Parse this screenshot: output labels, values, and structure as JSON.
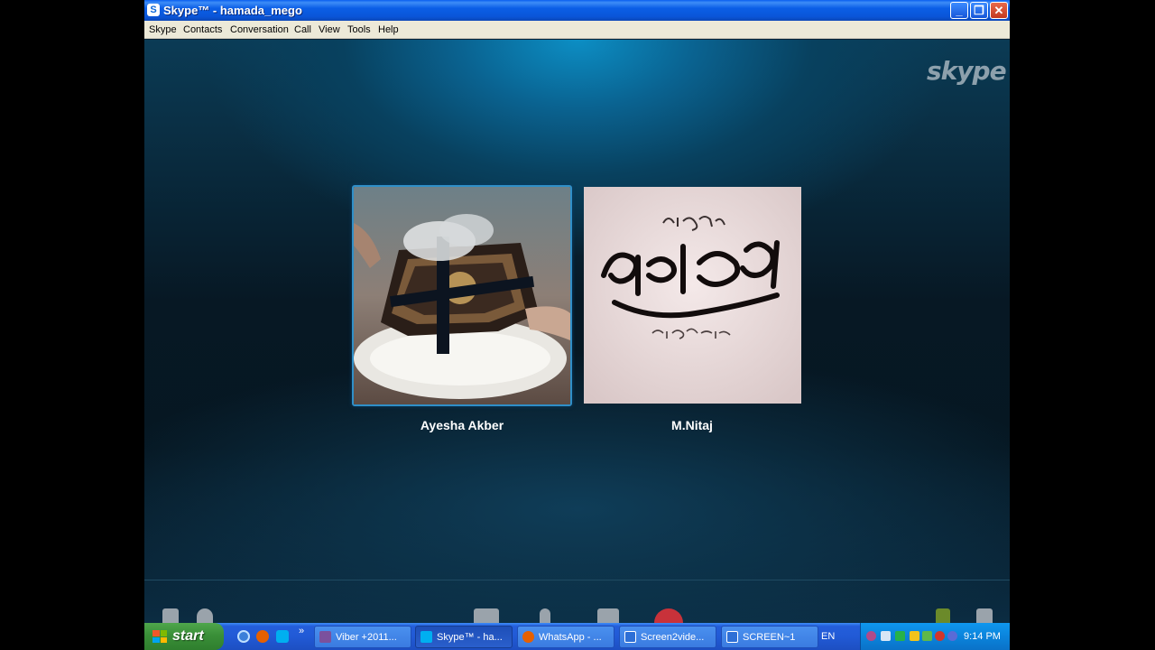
{
  "window": {
    "title": "Skype™ - hamada_mego",
    "app_icon_letter": "S",
    "controls": {
      "minimize": "_",
      "maximize": "❐",
      "close": "✕"
    }
  },
  "menu": [
    "Skype",
    "Contacts",
    "Conversation",
    "Call",
    "View",
    "Tools",
    "Help"
  ],
  "stage": {
    "logo": "skype",
    "contacts": [
      {
        "name": "Ayesha Akber",
        "avatar": "photo"
      },
      {
        "name": "M.Nitaj",
        "avatar": "calligraphy-image"
      }
    ]
  },
  "taskbar": {
    "start_label": "start",
    "quick_launch_more": "»",
    "tasks": [
      {
        "label": "Viber +2011...",
        "icon": "viber-icon",
        "color": "#7b519d"
      },
      {
        "label": "Skype™ - ha...",
        "icon": "skype-icon",
        "color": "#00aff0",
        "active": true
      },
      {
        "label": "WhatsApp - ...",
        "icon": "firefox-icon",
        "color": "#e66000"
      },
      {
        "label": "Screen2vide...",
        "icon": "screen2video-icon",
        "color": "#2d6fd6"
      },
      {
        "label": "SCREEN~1",
        "icon": "screen2video-icon",
        "color": "#2d6fd6"
      }
    ],
    "language": "EN",
    "clock": "9:14 PM"
  }
}
